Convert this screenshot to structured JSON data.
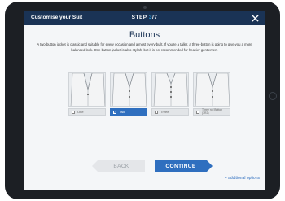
{
  "header": {
    "title": "Customise your Suit",
    "step_prefix": "STEP",
    "step_current": "3",
    "step_total": "/7",
    "close_icon": "close-icon"
  },
  "page": {
    "heading": "Buttons",
    "description": "A two-button jacket is classic and suitable for every occasion and almost every built. If you're a taller, a three-button is going to give you a more balanced look. One button jacket is also stylish, but it is not recommended for heavier gentlemen."
  },
  "options": [
    {
      "label": "One",
      "selected": false,
      "buttons": 1
    },
    {
      "label": "Two",
      "selected": true,
      "buttons": 2
    },
    {
      "label": "Three",
      "selected": false,
      "buttons": 3
    },
    {
      "label": "Three roll Button (3R2)",
      "selected": false,
      "buttons": 3
    }
  ],
  "nav": {
    "back_label": "BACK",
    "continue_label": "CONTINUE",
    "additional_label": "+ additional options"
  },
  "colors": {
    "header_bg": "#1a3355",
    "accent": "#2f6fbf",
    "step_highlight": "#2fa7e8"
  }
}
